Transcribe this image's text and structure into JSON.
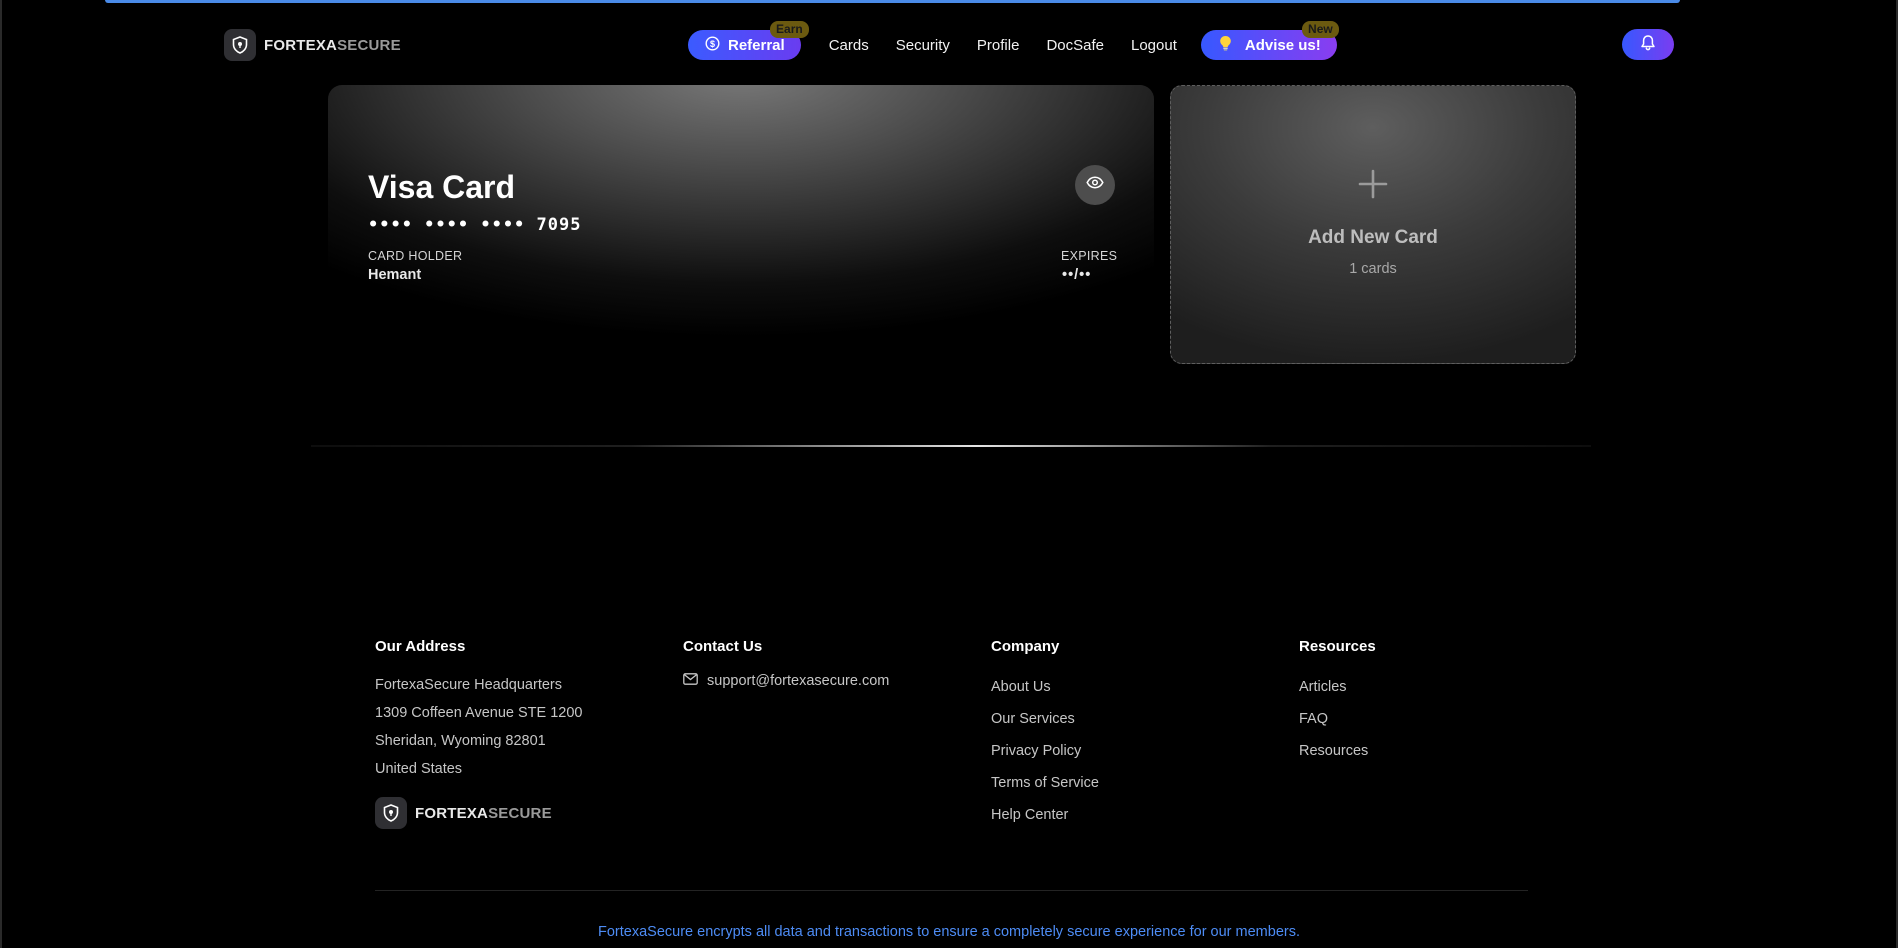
{
  "brand": {
    "name_primary": "FORTEXA",
    "name_secondary": "SECURE"
  },
  "nav": {
    "referral_label": "Referral",
    "referral_badge": "Earn",
    "links": [
      "Cards",
      "Security",
      "Profile",
      "DocSafe",
      "Logout"
    ],
    "advise_label": "Advise us!",
    "advise_badge": "New"
  },
  "card": {
    "title": "Visa Card",
    "number_masked": "•••• •••• •••• 7095",
    "holder_label": "CARD HOLDER",
    "holder_name": "Hemant",
    "expires_label": "EXPIRES",
    "expires_value": "••/••"
  },
  "add_card": {
    "title": "Add New Card",
    "count": "1 cards"
  },
  "footer": {
    "address": {
      "heading": "Our Address",
      "lines": [
        "FortexaSecure Headquarters",
        "1309 Coffeen Avenue STE 1200",
        "Sheridan, Wyoming 82801",
        "United States"
      ]
    },
    "contact": {
      "heading": "Contact Us",
      "email": "support@fortexasecure.com"
    },
    "company": {
      "heading": "Company",
      "links": [
        "About Us",
        "Our Services",
        "Privacy Policy",
        "Terms of Service",
        "Help Center"
      ]
    },
    "resources": {
      "heading": "Resources",
      "links": [
        "Articles",
        "FAQ",
        "Resources"
      ]
    },
    "note": "FortexaSecure encrypts all data and transactions to ensure a completely secure experience for our members."
  },
  "colors": {
    "accent_blue": "#3b5bff",
    "accent_purple": "#7a3df0",
    "link_blue": "#4d8cf5",
    "badge_gold": "#6b5a10"
  }
}
